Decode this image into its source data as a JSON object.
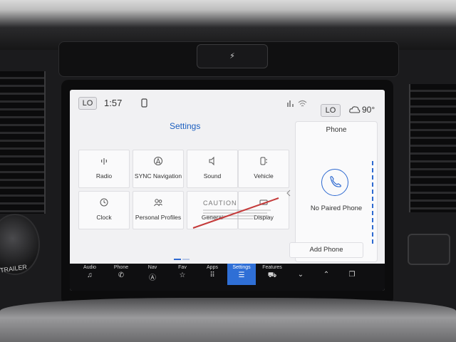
{
  "status_bar": {
    "temp_left": "LO",
    "time": "1:57",
    "temp_right": "LO",
    "outside_temp": "90°"
  },
  "settings": {
    "title": "Settings",
    "tiles": [
      {
        "label": "Radio",
        "icon": "radio-icon"
      },
      {
        "label": "SYNC Navigation",
        "icon": "navigation-icon"
      },
      {
        "label": "Sound",
        "icon": "speaker-icon"
      },
      {
        "label": "Vehicle",
        "icon": "vehicle-icon"
      },
      {
        "label": "Clock",
        "icon": "clock-icon"
      },
      {
        "label": "Personal Profiles",
        "icon": "profiles-icon"
      },
      {
        "label": "General",
        "icon": "general-icon"
      },
      {
        "label": "Display",
        "icon": "display-icon"
      }
    ]
  },
  "caution_sticker": {
    "title": "CAUTION"
  },
  "phone_panel": {
    "title": "Phone",
    "status": "No Paired Phone",
    "add_button": "Add Phone"
  },
  "bottom_nav": [
    {
      "label": "Audio",
      "icon": "music-note-icon"
    },
    {
      "label": "Phone",
      "icon": "phone-icon"
    },
    {
      "label": "Nav",
      "icon": "navigation-icon"
    },
    {
      "label": "Fav",
      "icon": "star-icon"
    },
    {
      "label": "Apps",
      "icon": "apps-grid-icon"
    },
    {
      "label": "Settings",
      "icon": "sliders-icon",
      "active": true
    },
    {
      "label": "Features",
      "icon": "car-icon"
    },
    {
      "label": "",
      "icon": "chevron-down-icon"
    },
    {
      "label": "",
      "icon": "chevron-up-icon"
    },
    {
      "label": "",
      "icon": "copy-icon"
    }
  ],
  "dashboard": {
    "knob_label": "TRAILER"
  },
  "colors": {
    "accent": "#2f6fd6",
    "screen_bg": "#f1f1f3",
    "nav_bg": "#0f0f11"
  }
}
